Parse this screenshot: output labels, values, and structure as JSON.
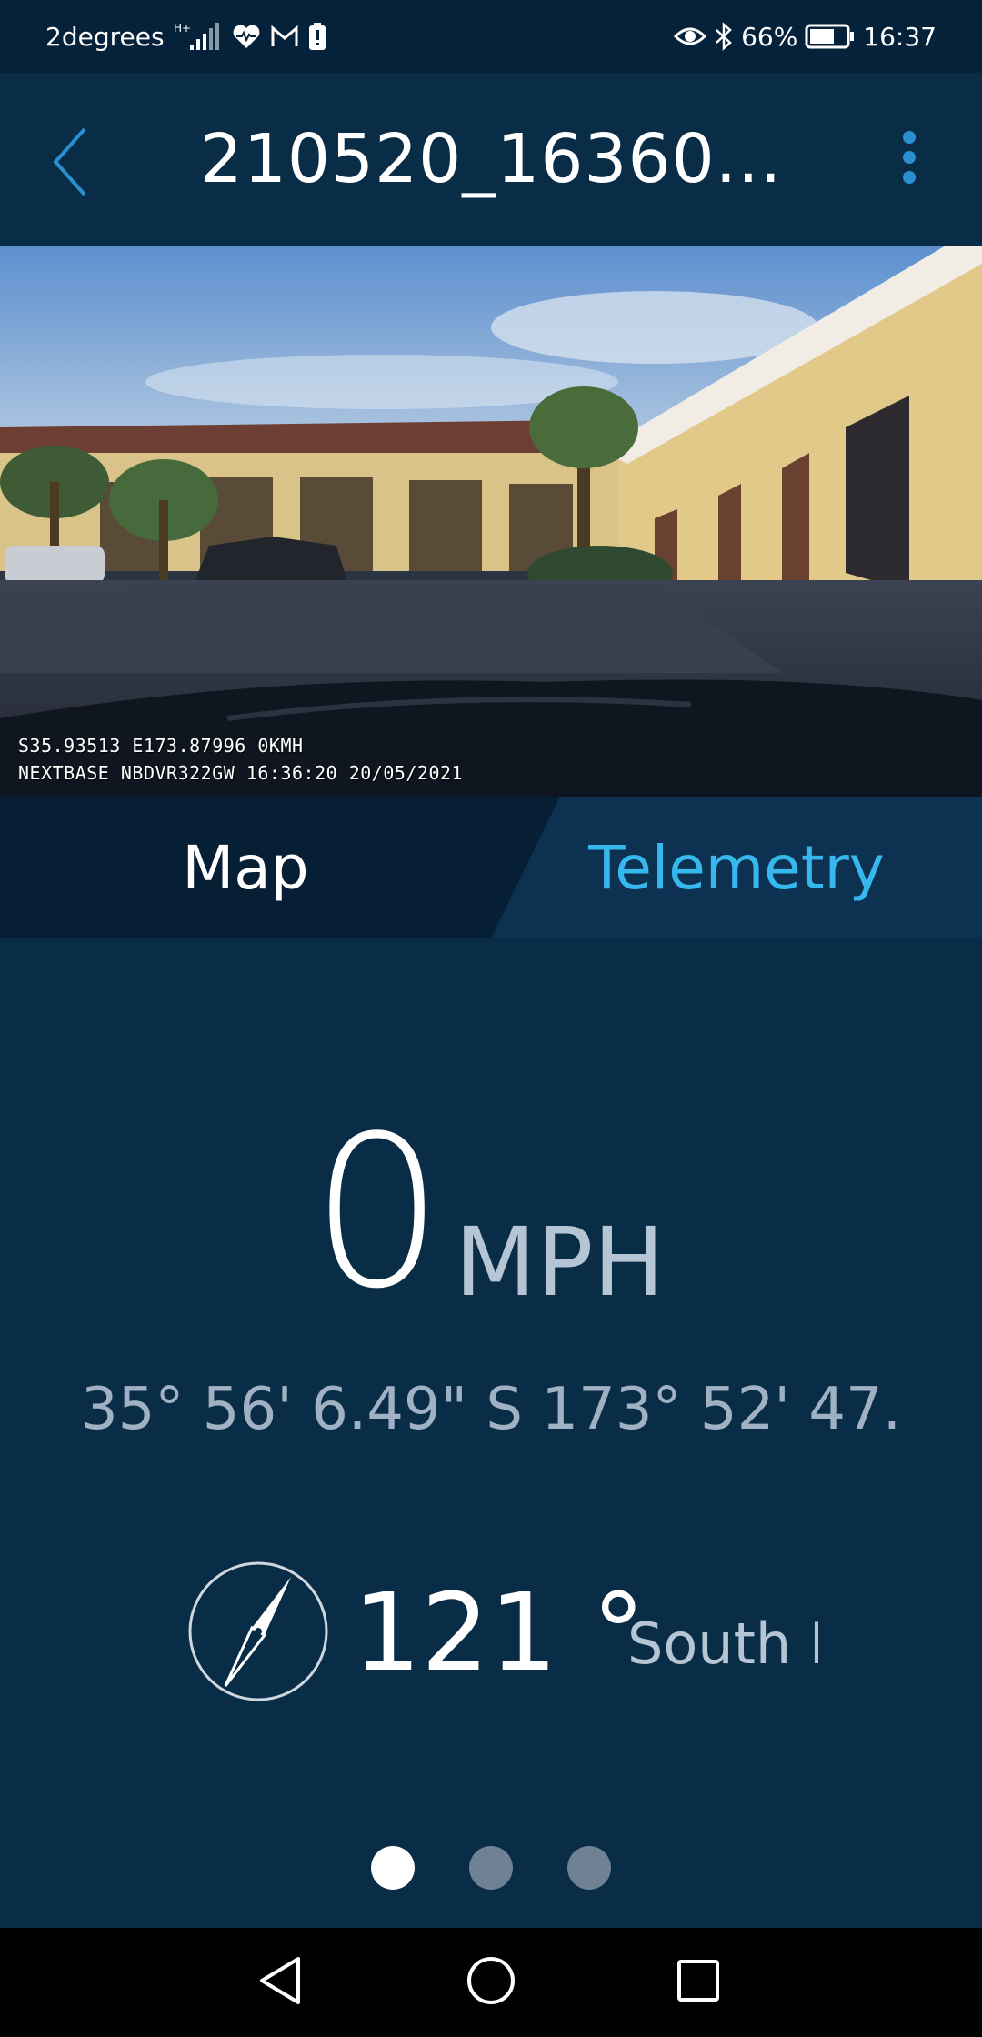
{
  "status_bar": {
    "carrier": "2degrees",
    "network_type": "H+",
    "battery_percent": "66%",
    "time": "16:37",
    "icons": [
      "signal-icon",
      "health-icon",
      "gmail-icon",
      "battery-alert-icon",
      "eye-icon",
      "bluetooth-icon",
      "battery-icon"
    ]
  },
  "header": {
    "title": "210520_16360...",
    "back_icon": "chevron-left-icon",
    "menu_icon": "more-vertical-icon"
  },
  "video": {
    "overlay_line1": "S35.93513 E173.87996 0KMH",
    "overlay_line2": "NEXTBASE NBDVR322GW 16:36:20 20/05/2021"
  },
  "tabs": [
    {
      "label": "Map",
      "active": false
    },
    {
      "label": "Telemetry",
      "active": true
    }
  ],
  "telemetry": {
    "speed_value": "0",
    "speed_unit": "MPH",
    "coordinates": "35° 56' 6.49\" S 173° 52' 47.",
    "heading_value": "121 °",
    "heading_direction": "South E",
    "heading_degrees": 121
  },
  "pager": {
    "pages": 3,
    "active_index": 0
  },
  "nav_bar": {
    "icons": [
      "back-triangle-icon",
      "home-circle-icon",
      "recents-square-icon"
    ]
  },
  "colors": {
    "background": "#0a2d47",
    "status_bar": "#05223a",
    "accent": "#36b7ee",
    "tab_inactive_bg": "#061f35"
  }
}
